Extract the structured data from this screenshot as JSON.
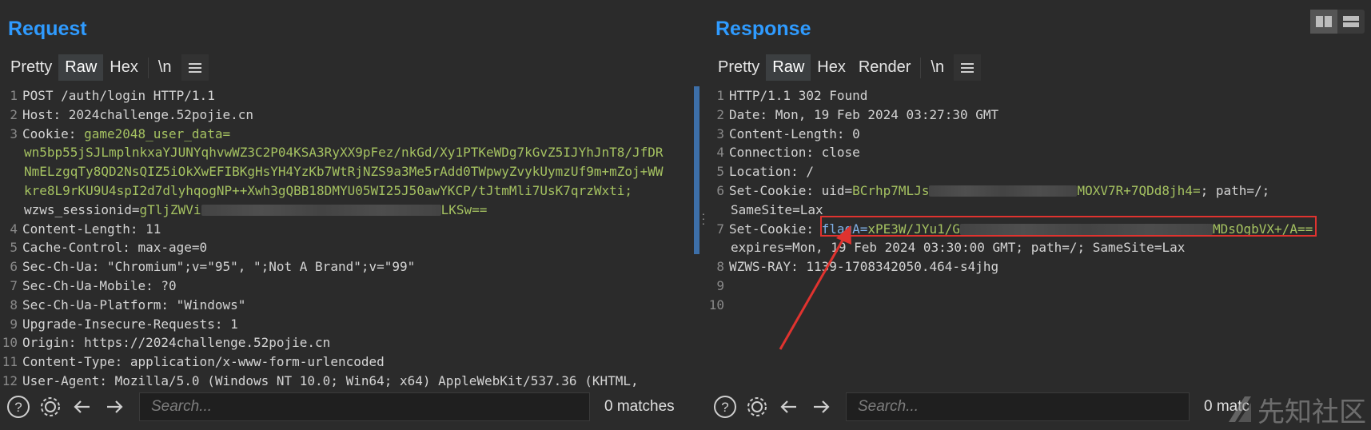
{
  "request": {
    "title": "Request",
    "tabs": [
      "Pretty",
      "Raw",
      "Hex",
      "\\n"
    ],
    "active_tab": "Raw",
    "lines": [
      {
        "n": "1",
        "text": "POST /auth/login HTTP/1.1"
      },
      {
        "n": "2",
        "text": "Host: 2024challenge.52pojie.cn"
      },
      {
        "n": "3",
        "name": "Cookie: ",
        "value": "game2048_user_data="
      },
      {
        "n": "",
        "value": "wn5bp55jSJLmplnkxaYJUNYqhvwWZ3C2P04KSA3RyXX9pFez/nkGd/Xy1PTKeWDg7kGvZ5IJYhJnT8/JfDR"
      },
      {
        "n": "",
        "value": "NmELzgqTy8QD2NsQIZ5iOkXwEFIBKgHsYH4YzKb7WtRjNZS9a3Me5rAdd0TWpwyZvykUymzUf9m+mZoj+WW"
      },
      {
        "n": "",
        "value": "kre8L9rKU9U4spI2d7dlyhqogNP++Xwh3gQBB18DMYU05WI25J50awYKCP/tJtmMli7UsK7qrzWxti;"
      },
      {
        "n": "",
        "name": "wzws_sessionid=",
        "value": "gTljZWVi",
        "tail": "LKSw=="
      },
      {
        "n": "4",
        "text": "Content-Length: 11"
      },
      {
        "n": "5",
        "text": "Cache-Control: max-age=0"
      },
      {
        "n": "6",
        "text": "Sec-Ch-Ua: \"Chromium\";v=\"95\", \";Not A Brand\";v=\"99\""
      },
      {
        "n": "7",
        "text": "Sec-Ch-Ua-Mobile: ?0"
      },
      {
        "n": "8",
        "text": "Sec-Ch-Ua-Platform: \"Windows\""
      },
      {
        "n": "9",
        "text": "Upgrade-Insecure-Requests: 1"
      },
      {
        "n": "10",
        "text": "Origin: https://2024challenge.52pojie.cn"
      },
      {
        "n": "11",
        "text": "Content-Type: application/x-www-form-urlencoded"
      },
      {
        "n": "12",
        "text": "User-Agent: Mozilla/5.0 (Windows NT 10.0; Win64; x64) AppleWebKit/537.36 (KHTML,"
      }
    ],
    "search_placeholder": "Search...",
    "matches": "0 matches"
  },
  "response": {
    "title": "Response",
    "tabs": [
      "Pretty",
      "Raw",
      "Hex",
      "Render",
      "\\n"
    ],
    "active_tab": "Raw",
    "lines": [
      {
        "n": "1",
        "text": "HTTP/1.1 302 Found"
      },
      {
        "n": "2",
        "text": "Date: Mon, 19 Feb 2024 03:27:30 GMT"
      },
      {
        "n": "3",
        "text": "Content-Length: 0"
      },
      {
        "n": "4",
        "text": "Connection: close"
      },
      {
        "n": "5",
        "text": "Location: /"
      },
      {
        "n": "6",
        "name": "Set-Cookie: uid=",
        "value": "BCrhp7MLJs",
        "tail": "MOXV7R+7QDd8jh4=",
        "after": "; path=/;"
      },
      {
        "n": "",
        "text": "SameSite=Lax"
      },
      {
        "n": "7",
        "name": "Set-Cookie: ",
        "key": "flagA=",
        "value": "xPE3W/JYu1/G",
        "tail": "MDsOgbVX+/A=="
      },
      {
        "n": "",
        "pre": "expires=Mon, 19",
        "text": " Feb 2024 03:30:00 GMT; path=/; SameSite=Lax"
      },
      {
        "n": "8",
        "pre": "WZWS-RAY: 1139",
        "text": "-1708342050.464-s4jhg"
      },
      {
        "n": "9",
        "text": ""
      },
      {
        "n": "10",
        "text": ""
      }
    ],
    "search_placeholder": "Search...",
    "matches": "0 matc"
  },
  "watermark": "先知社区",
  "accent": "#2f9bff",
  "highlight_color": "#e0332f",
  "value_color": "#a5c261"
}
